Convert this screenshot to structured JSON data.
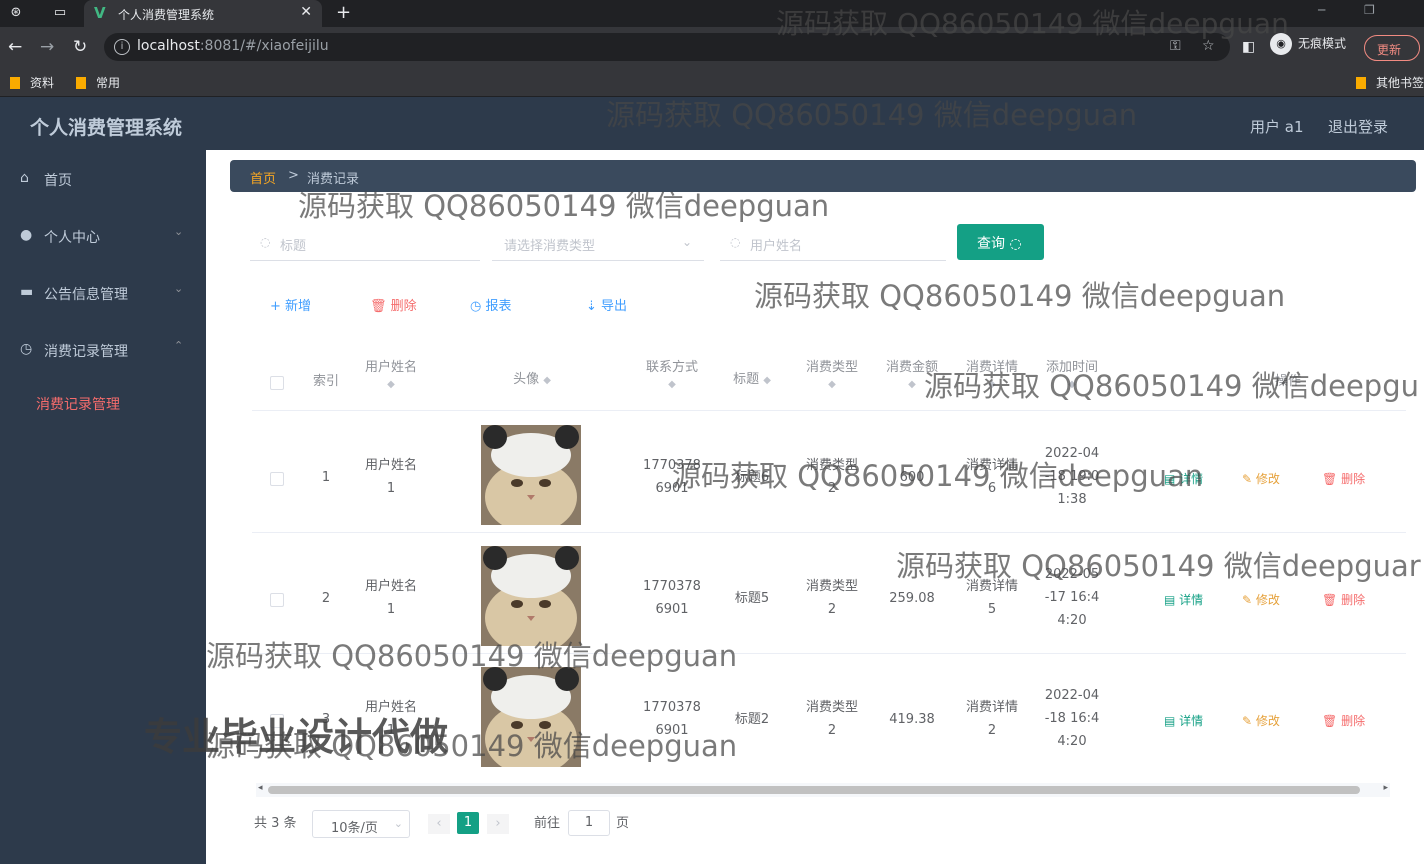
{
  "browser": {
    "tab_title": "个人消费管理系统",
    "url_host": "localhost",
    "url_rest": ":8081/#/xiaofeijilu",
    "incognito_label": "无痕模式",
    "update_label": "更新",
    "bookmarks": [
      "资料",
      "常用"
    ],
    "other_bookmarks": "其他书签"
  },
  "app": {
    "title": "个人消费管理系统",
    "user_label": "用户 a1",
    "logout_label": "退出登录"
  },
  "sidebar": {
    "items": [
      {
        "label": "首页",
        "icon": "home-icon"
      },
      {
        "label": "个人中心",
        "icon": "user-icon"
      },
      {
        "label": "公告信息管理",
        "icon": "briefcase-icon"
      },
      {
        "label": "消费记录管理",
        "icon": "clock-icon"
      }
    ],
    "active_sub": "消费记录管理"
  },
  "breadcrumb": {
    "home": "首页",
    "sep": ">",
    "current": "消费记录"
  },
  "search": {
    "title_placeholder": "标题",
    "type_placeholder": "请选择消费类型",
    "name_placeholder": "用户姓名",
    "query_label": "查询"
  },
  "actions": {
    "add": "新增",
    "delete": "删除",
    "report": "报表",
    "export": "导出"
  },
  "table": {
    "headers": {
      "index": "索引",
      "name": "用户姓名",
      "avatar": "头像",
      "phone": "联系方式",
      "title": "标题",
      "type": "消费类型",
      "amount": "消费金额",
      "detail": "消费详情",
      "time": "添加时间",
      "ops": "操作"
    },
    "rows": [
      {
        "index": "1",
        "name1": "用户姓名",
        "name2": "1",
        "phone1": "1770378",
        "phone2": "6901",
        "title": "标题6",
        "type1": "消费类型",
        "type2": "2",
        "amount": "600",
        "detail1": "消费详情",
        "detail2": "6",
        "time1": "2022-04",
        "time2": "-18 19:0",
        "time3": "1:38"
      },
      {
        "index": "2",
        "name1": "用户姓名",
        "name2": "1",
        "phone1": "1770378",
        "phone2": "6901",
        "title": "标题5",
        "type1": "消费类型",
        "type2": "2",
        "amount": "259.08",
        "detail1": "消费详情",
        "detail2": "5",
        "time1": "2022-05",
        "time2": "-17 16:4",
        "time3": "4:20"
      },
      {
        "index": "3",
        "name1": "用户姓名",
        "name2": "1",
        "phone1": "1770378",
        "phone2": "6901",
        "title": "标题2",
        "type1": "消费类型",
        "type2": "2",
        "amount": "419.38",
        "detail1": "消费详情",
        "detail2": "2",
        "time1": "2022-04",
        "time2": "-18 16:4",
        "time3": "4:20"
      }
    ],
    "op_labels": {
      "detail": "详情",
      "edit": "修改",
      "delete": "删除"
    }
  },
  "pagination": {
    "total": "共 3 条",
    "size": "10条/页",
    "page": "1",
    "goto": "前往",
    "goto_value": "1",
    "page_unit": "页"
  },
  "watermarks": {
    "text": "源码获取 QQ86050149 微信deepguan",
    "text_cut1": "源码获取 QQ86050149 微信deepgu",
    "text_cut2": "源码获取 QQ86050149 微信deepguar",
    "big": "专业毕业设计代做"
  },
  "colors": {
    "accent": "#14a085",
    "danger": "#f56c6c",
    "sidebar": "#2d3a4b",
    "active": "#f56c6c"
  }
}
